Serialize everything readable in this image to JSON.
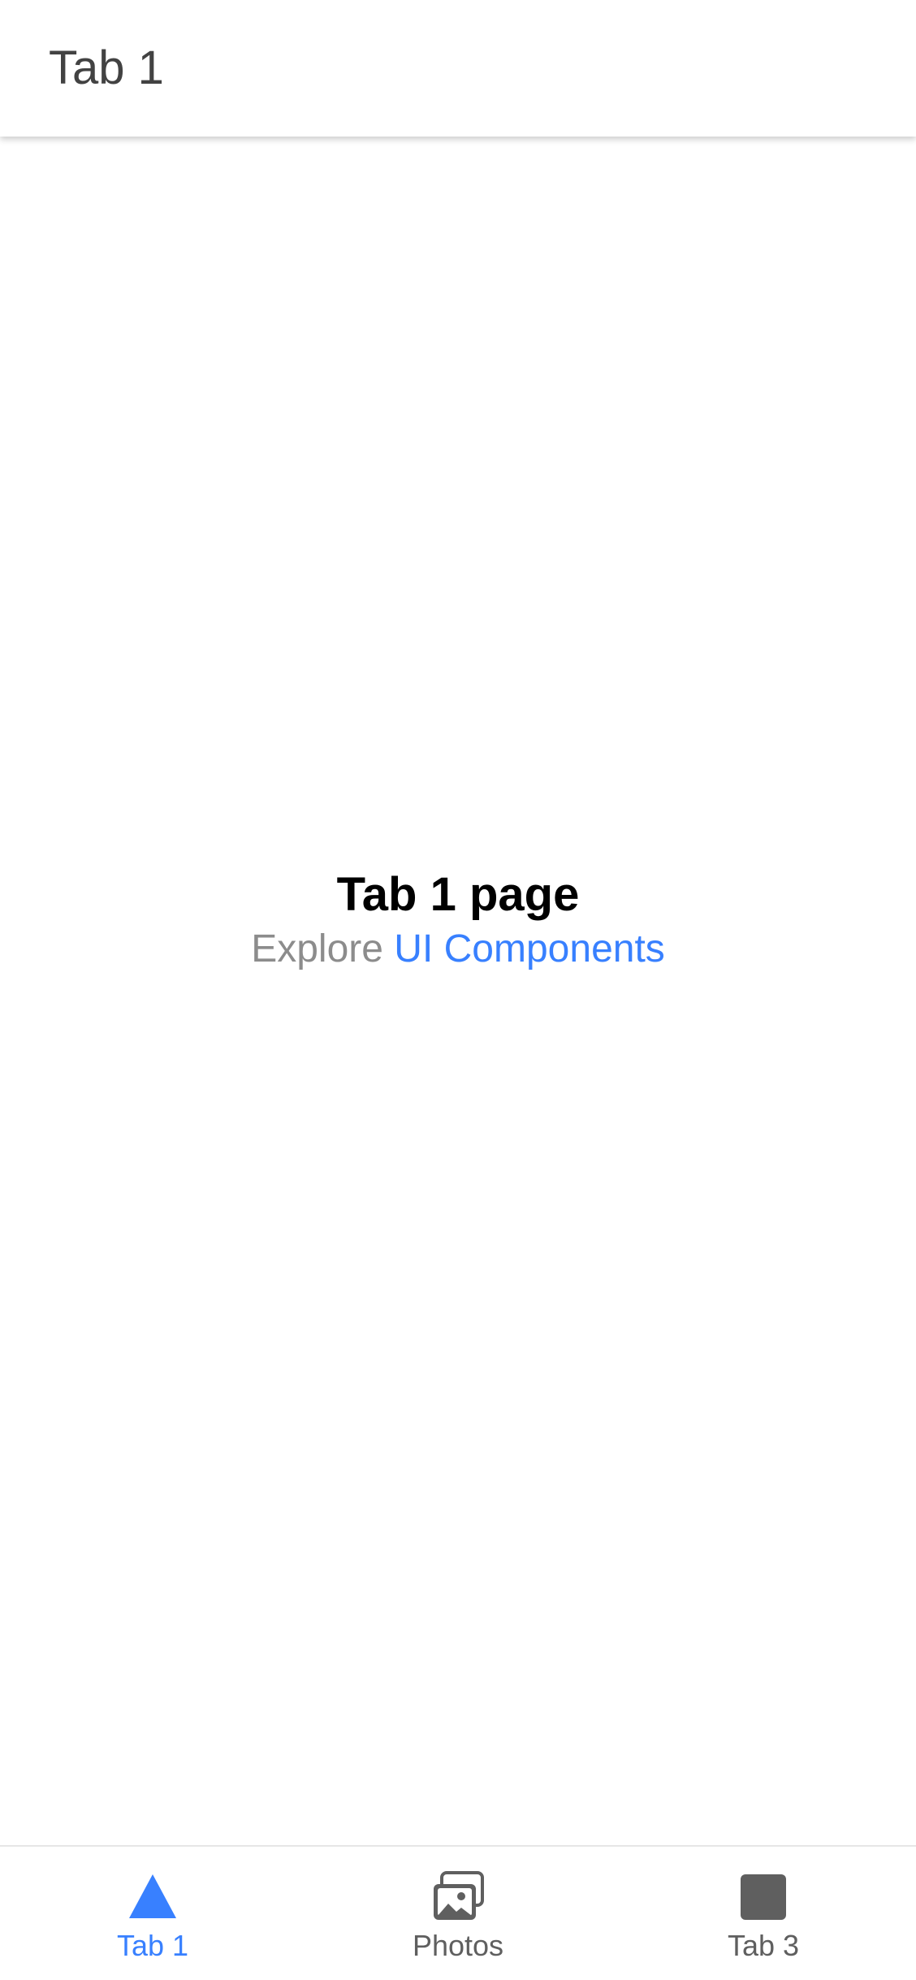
{
  "header": {
    "title": "Tab 1"
  },
  "main": {
    "heading": "Tab 1 page",
    "explore_prefix": "Explore",
    "explore_link": "UI Components"
  },
  "tabbar": {
    "tabs": [
      {
        "label": "Tab 1",
        "icon": "triangle-icon",
        "selected": true
      },
      {
        "label": "Photos",
        "icon": "images-icon",
        "selected": false
      },
      {
        "label": "Tab 3",
        "icon": "square-icon",
        "selected": false
      }
    ]
  },
  "colors": {
    "accent": "#3880ff",
    "inactive_tab": "#5f5f5f",
    "header_text": "#424242",
    "muted_text": "#8c8c8c"
  }
}
